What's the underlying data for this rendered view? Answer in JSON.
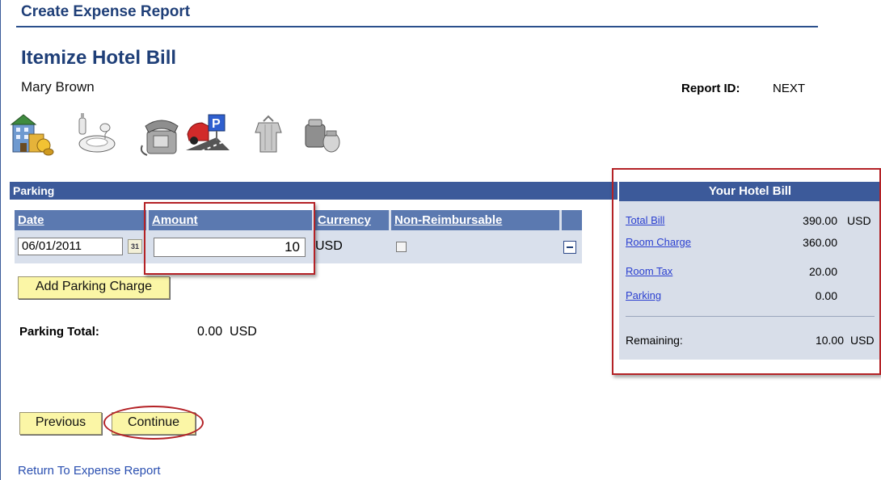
{
  "header": {
    "title": "Create Expense Report"
  },
  "page": {
    "title": "Itemize Hotel Bill",
    "employee": "Mary Brown"
  },
  "report": {
    "id_label": "Report ID:",
    "id_value": "NEXT"
  },
  "icons": [
    "hotel-icon",
    "meal-icon",
    "phone-icon",
    "parking-icon",
    "laundry-icon",
    "misc-icon"
  ],
  "parking": {
    "section_title": "Parking",
    "columns": {
      "date": "Date",
      "amount": "Amount",
      "currency": "Currency",
      "non_reimbursable": "Non-Reimbursable"
    },
    "row": {
      "date": "06/01/2011",
      "amount": "10",
      "currency": "USD",
      "non_reimbursable": false
    },
    "add_button": "Add Parking Charge",
    "total_label": "Parking Total:",
    "total_value": "0.00  USD"
  },
  "hotel_bill": {
    "title": "Your Hotel Bill",
    "total_label": "Total Bill",
    "total_value": "390.00",
    "total_currency": "USD",
    "room_charge_label": "Room Charge",
    "room_charge_value": "360.00",
    "room_tax_label": "Room Tax",
    "room_tax_value": "20.00",
    "parking_label": "Parking",
    "parking_value": "0.00",
    "remaining_label": "Remaining:",
    "remaining_value": "10.00",
    "remaining_currency": "USD"
  },
  "nav": {
    "previous": "Previous",
    "continue": "Continue",
    "return_link": "Return To Expense Report"
  },
  "colors": {
    "header_blue": "#1f3f78",
    "bar_blue": "#3c5a9a",
    "button_yellow": "#fbf6a6",
    "highlight_red": "#b42226"
  }
}
